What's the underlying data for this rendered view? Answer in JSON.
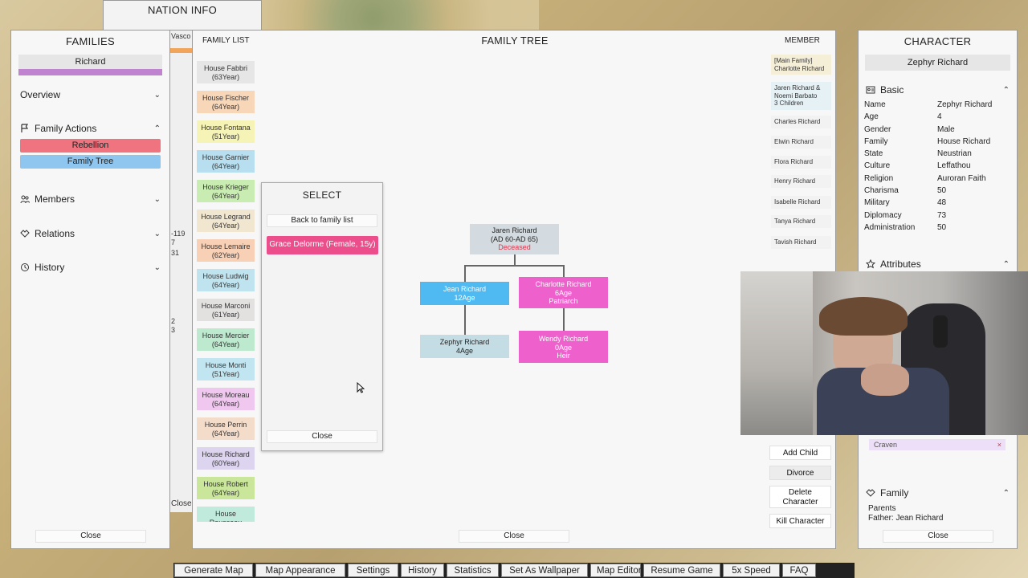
{
  "nation_info": {
    "title": "NATION INFO"
  },
  "back_strip": {
    "t1": "Vasco",
    "t2": "-119",
    "t3": "7",
    "t4": "31",
    "t5": "2",
    "t6": "3",
    "t7": "Close"
  },
  "families": {
    "title": "FAMILIES",
    "selected": "Richard",
    "sections": {
      "overview": "Overview",
      "family_actions": "Family Actions",
      "members": "Members",
      "relations": "Relations",
      "history": "History"
    },
    "actions": {
      "rebellion": "Rebellion",
      "family_tree": "Family Tree"
    },
    "close": "Close",
    "colors": {
      "purple": "#c083cf",
      "rebellion": "#f0747f",
      "family_tree": "#8fc6ef"
    }
  },
  "tree_panel": {
    "family_list_title": "FAMILY LIST",
    "title": "FAMILY TREE",
    "member_title": "MEMBER",
    "close": "Close",
    "houses": [
      {
        "name": "House Fabbri",
        "years": "(63Year)",
        "color": "#e6e6e6"
      },
      {
        "name": "House Fischer",
        "years": "(64Year)",
        "color": "#f8d6b8"
      },
      {
        "name": "House Fontana",
        "years": "(51Year)",
        "color": "#f6f3b7"
      },
      {
        "name": "House Garnier",
        "years": "(64Year)",
        "color": "#b7dff0"
      },
      {
        "name": "House Krieger",
        "years": "(64Year)",
        "color": "#c8ecb1"
      },
      {
        "name": "House Legrand",
        "years": "(64Year)",
        "color": "#f1e6cf"
      },
      {
        "name": "House Lemaire",
        "years": "(62Year)",
        "color": "#f8d0b6"
      },
      {
        "name": "House Ludwig",
        "years": "(64Year)",
        "color": "#c0e4ef"
      },
      {
        "name": "House Marconi",
        "years": "(61Year)",
        "color": "#e3e0e0"
      },
      {
        "name": "House Mercier",
        "years": "(64Year)",
        "color": "#bde9cf"
      },
      {
        "name": "House Monti",
        "years": "(51Year)",
        "color": "#c2e6f1"
      },
      {
        "name": "House Moreau",
        "years": "(64Year)",
        "color": "#f0c8ef"
      },
      {
        "name": "House Perrin",
        "years": "(64Year)",
        "color": "#f4dccb"
      },
      {
        "name": "House Richard",
        "years": "(60Year)",
        "color": "#ddd4ef"
      },
      {
        "name": "House Robert",
        "years": "(64Year)",
        "color": "#c9e69b"
      },
      {
        "name": "House",
        "years": "Rousseau",
        "color": "#bfeadc"
      }
    ],
    "members": [
      {
        "line1": "[Main Family]",
        "line2": "Charlotte Richard",
        "line3": "",
        "color": "#f6efd8"
      },
      {
        "line1": "Jaren Richard &",
        "line2": "Noemi Barbato",
        "line3": "3 Children",
        "color": "#e6f1f6"
      },
      {
        "line1": "Charles Richard",
        "line2": "",
        "line3": "",
        "color": "#f2f2f2"
      },
      {
        "line1": "Elwin Richard",
        "line2": "",
        "line3": "",
        "color": "#f2f2f2"
      },
      {
        "line1": "Flora Richard",
        "line2": "",
        "line3": "",
        "color": "#f2f2f2"
      },
      {
        "line1": "Henry Richard",
        "line2": "",
        "line3": "",
        "color": "#f2f2f2"
      },
      {
        "line1": "Isabelle Richard",
        "line2": "",
        "line3": "",
        "color": "#f2f2f2"
      },
      {
        "line1": "Tanya Richard",
        "line2": "",
        "line3": "",
        "color": "#f2f2f2"
      },
      {
        "line1": "Tavish Richard",
        "line2": "",
        "line3": "",
        "color": "#f2f2f2"
      }
    ],
    "tree": {
      "root": {
        "name": "Jaren Richard",
        "years": "(AD 60-AD 65)",
        "status": "Deceased"
      },
      "jean": {
        "name": "Jean Richard",
        "age": "12Age"
      },
      "charlotte": {
        "name": "Charlotte Richard",
        "age": "6Age",
        "role": "Patriarch"
      },
      "zephyr": {
        "name": "Zephyr Richard",
        "age": "4Age"
      },
      "wendy": {
        "name": "Wendy Richard",
        "age": "0Age",
        "role": "Heir"
      },
      "colors": {
        "root": "#d4dbe0",
        "jean": "#4fb9f2",
        "charlotte": "#ee60cc",
        "zephyr": "#c4dde4",
        "wendy": "#ee60cc",
        "deceased": "#e0344c"
      }
    },
    "member_actions": {
      "add_child": "Add Child",
      "divorce": "Divorce",
      "delete_character": "Delete Character",
      "kill_character": "Kill Character"
    }
  },
  "select_popup": {
    "title": "SELECT",
    "back": "Back to family list",
    "option": "Grace Delorme (Female, 15y)",
    "option_color": "#ec4e8c",
    "close": "Close"
  },
  "character": {
    "title": "CHARACTER",
    "name": "Zephyr Richard",
    "basic_title": "Basic",
    "attributes_title": "Attributes",
    "fields": [
      {
        "k": "Name",
        "v": "Zephyr Richard"
      },
      {
        "k": "Age",
        "v": "4"
      },
      {
        "k": "Gender",
        "v": "Male"
      },
      {
        "k": "Family",
        "v": "House Richard"
      },
      {
        "k": "State",
        "v": "Neustrian"
      },
      {
        "k": "Culture",
        "v": "Leffathou"
      },
      {
        "k": "Religion",
        "v": "Auroran Faith"
      },
      {
        "k": "Charisma",
        "v": "50"
      },
      {
        "k": "Military",
        "v": "48"
      },
      {
        "k": "Diplomacy",
        "v": "73"
      },
      {
        "k": "Administration",
        "v": "50"
      }
    ],
    "trait": "Craven",
    "trait_remove": "×",
    "family_title": "Family",
    "parents_label": "Parents",
    "father": "Father: Jean Richard",
    "close": "Close"
  },
  "bottom_bar": [
    "Generate Map",
    "Map Appearance",
    "Settings",
    "History",
    "Statistics",
    "Set As Wallpaper",
    "Map Editor",
    "Resume Game",
    "5x Speed",
    "FAQ"
  ]
}
